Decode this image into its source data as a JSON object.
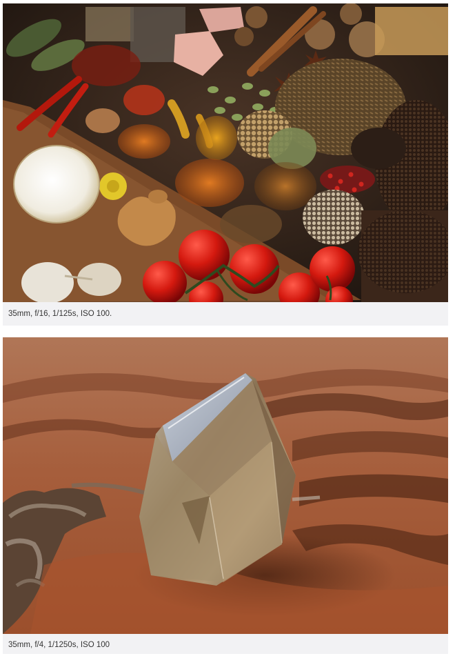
{
  "figures": [
    {
      "subject": "spices-photo",
      "caption": "35mm, f/16, 1/125s, ISO 100."
    },
    {
      "subject": "crystal-photo",
      "caption": "35mm, f/4, 1/1250s, ISO 100"
    }
  ],
  "colors": {
    "caption_background": "#f2f2f4",
    "caption_text": "#333333"
  }
}
